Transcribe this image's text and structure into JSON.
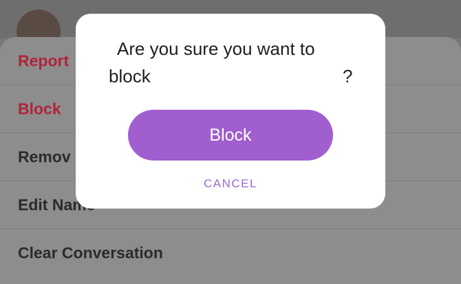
{
  "sheet": {
    "items": [
      {
        "label": "Report"
      },
      {
        "label": "Block"
      },
      {
        "label": "Remov"
      },
      {
        "label": "Edit Name"
      },
      {
        "label": "Clear Conversation"
      }
    ]
  },
  "modal": {
    "title_line1": "Are you sure you want to",
    "title_line2": "block",
    "title_suffix": "?",
    "confirm_label": "Block",
    "cancel_label": "CANCEL"
  },
  "colors": {
    "accent": "#a15ecf",
    "danger": "#b0243b"
  },
  "icons": {
    "avatar": "avatar"
  }
}
